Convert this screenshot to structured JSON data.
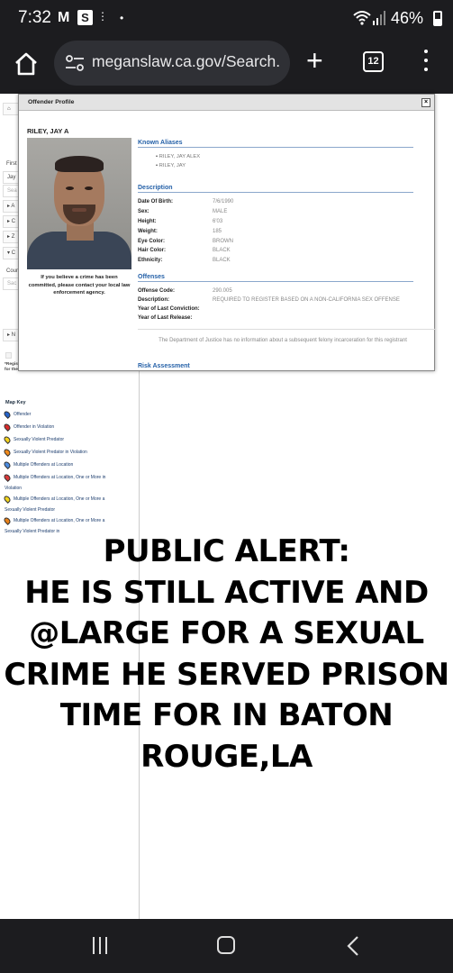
{
  "status_bar": {
    "time": "7:32",
    "app_icons": [
      "gmail-icon",
      "s-app-icon",
      "dots-icon"
    ],
    "dot": "•",
    "battery": "46%"
  },
  "browser": {
    "url": "meganslaw.ca.gov/Search.",
    "tab_count": "12"
  },
  "sidebar": {
    "rows": [
      "First",
      "Jay",
      "Sea",
      "A",
      "C",
      "Z",
      "C",
      "Coun",
      "Sac",
      "N"
    ],
    "register_note": "*Registrants ... through the 'Show List' function and will display for the associated county pursuant to",
    "penal_code_link": "Penal Code § 290.46.",
    "map_key_title": "Map Key",
    "map_key": [
      {
        "label": "Offender",
        "color": "#2563c9"
      },
      {
        "label": "Offender in Violation",
        "color": "#d92b2b"
      },
      {
        "label": "Sexually Violent Predator",
        "color": "#f3d21f"
      },
      {
        "label": "Sexually Violent Predator in Violation",
        "color": "#f08a1b"
      },
      {
        "label": "Multiple Offenders at Location",
        "color": "#4c8ce0"
      },
      {
        "label": "Multiple Offenders at Location, One or More in Violation",
        "color": "#d93a3a"
      },
      {
        "label": "Multiple Offenders at Location, One or More a Sexually Violent Predator",
        "color": "#f1d41d"
      },
      {
        "label": "Multiple Offenders at Location, One or More a Sexually Violent Predator in",
        "color": "#e9821a"
      }
    ]
  },
  "modal": {
    "title": "Offender Profile",
    "close": "×",
    "name": "RILEY, JAY A",
    "warning": "If you believe a crime has been committed, please contact your local law enforcement agency.",
    "known_aliases_header": "Known Aliases",
    "aliases": [
      "RILEY, JAY ALEX",
      "RILEY, JAY"
    ],
    "description_header": "Description",
    "description": [
      {
        "label": "Date Of Birth:",
        "value": "7/6/1990"
      },
      {
        "label": "Sex:",
        "value": "MALE"
      },
      {
        "label": "Height:",
        "value": "6'03"
      },
      {
        "label": "Weight:",
        "value": "185"
      },
      {
        "label": "Eye Color:",
        "value": "BROWN"
      },
      {
        "label": "Hair Color:",
        "value": "BLACK"
      },
      {
        "label": "Ethnicity:",
        "value": "BLACK"
      }
    ],
    "offenses_header": "Offenses",
    "offenses": [
      {
        "label": "Offense Code:",
        "value": "290.005"
      },
      {
        "label": "Description:",
        "value": "REQUIRED TO REGISTER BASED ON A NON-CALIFORNIA SEX OFFENSE"
      },
      {
        "label": "Year of Last Conviction:",
        "value": ""
      },
      {
        "label": "Year of Last Release:",
        "value": ""
      }
    ],
    "doj_note": "The Department of Justice has no information about a subsequent felony incarceration for this registrant",
    "risk_header": "Risk Assessment"
  },
  "alert": {
    "lines": [
      "PUBLIC ALERT:",
      "HE IS STILL ACTIVE AND",
      "@LARGE FOR A SEXUAL",
      "CRIME HE SERVED PRISON",
      "TIME FOR IN BATON",
      "ROUGE,LA"
    ]
  }
}
